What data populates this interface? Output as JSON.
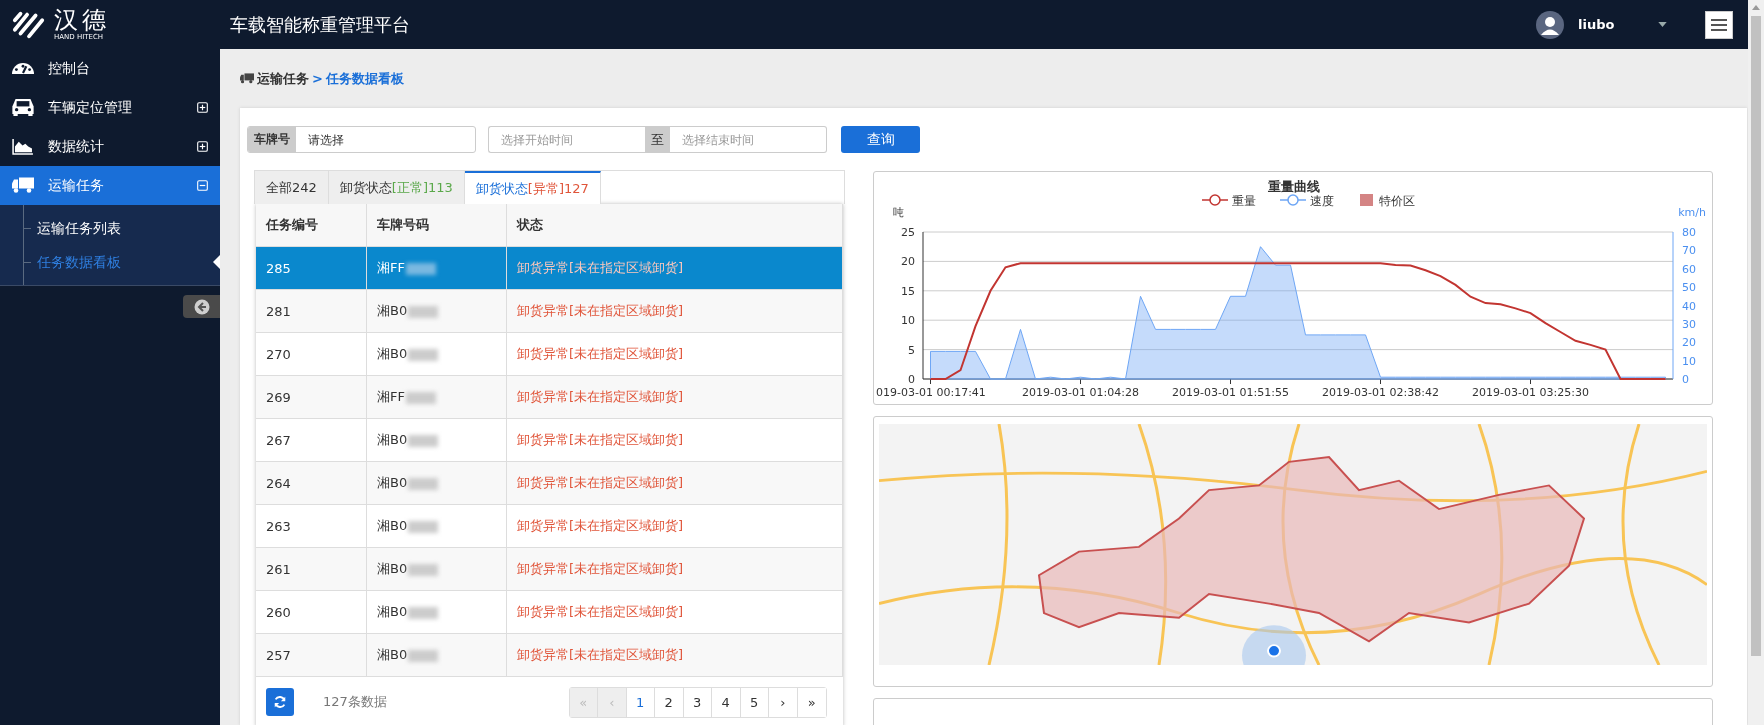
{
  "logo": {
    "name": "汉德",
    "subtitle": "HAND HITECH"
  },
  "header": {
    "title": "车载智能称重管理平台",
    "user": "liubo"
  },
  "sidebar": {
    "items": [
      {
        "label": "控制台",
        "kind": "gauge",
        "selected": false
      },
      {
        "label": "车辆定位管理",
        "kind": "car",
        "expanded": false,
        "selected": false
      },
      {
        "label": "数据统计",
        "kind": "chart",
        "expanded": false,
        "selected": false
      },
      {
        "label": "运输任务",
        "kind": "truck",
        "expanded": true,
        "selected": true,
        "children": [
          {
            "label": "运输任务列表",
            "selected": false
          },
          {
            "label": "任务数据看板",
            "selected": true
          }
        ]
      }
    ]
  },
  "breadcrumb": {
    "items": [
      "运输任务",
      "任务数据看板"
    ],
    "separator": ">"
  },
  "filters": {
    "plate_label": "车牌号",
    "plate_placeholder": "请选择",
    "start_placeholder": "选择开始时间",
    "range_separator": "至",
    "end_placeholder": "选择结束时间",
    "query_button": "查询"
  },
  "tabs": [
    {
      "label": "全部",
      "count": "242",
      "selected": false
    },
    {
      "label": "卸货状态",
      "status": "[正常]",
      "count": "113",
      "color": "#5aa84a",
      "selected": false
    },
    {
      "label": "卸货状态",
      "status": "[异常]",
      "count": "127",
      "color": "#e0553a",
      "selected": true
    }
  ],
  "table": {
    "columns": [
      "任务编号",
      "车牌号码",
      "状态"
    ],
    "rows": [
      {
        "id": "285",
        "plate": "湘FF",
        "status": "卸货异常[未在指定区域卸货]",
        "selected": true
      },
      {
        "id": "281",
        "plate": "湘B0",
        "status": "卸货异常[未在指定区域卸货]",
        "selected": false
      },
      {
        "id": "270",
        "plate": "湘B0",
        "status": "卸货异常[未在指定区域卸货]",
        "selected": false
      },
      {
        "id": "269",
        "plate": "湘FF",
        "status": "卸货异常[未在指定区域卸货]",
        "selected": false
      },
      {
        "id": "267",
        "plate": "湘B0",
        "status": "卸货异常[未在指定区域卸货]",
        "selected": false
      },
      {
        "id": "264",
        "plate": "湘B0",
        "status": "卸货异常[未在指定区域卸货]",
        "selected": false
      },
      {
        "id": "263",
        "plate": "湘B0",
        "status": "卸货异常[未在指定区域卸货]",
        "selected": false
      },
      {
        "id": "261",
        "plate": "湘B0",
        "status": "卸货异常[未在指定区域卸货]",
        "selected": false
      },
      {
        "id": "260",
        "plate": "湘B0",
        "status": "卸货异常[未在指定区域卸货]",
        "selected": false
      },
      {
        "id": "257",
        "plate": "湘B0",
        "status": "卸货异常[未在指定区域卸货]",
        "selected": false
      }
    ]
  },
  "pagination": {
    "total": "127条数据",
    "pages": [
      {
        "label": "«",
        "disabled": true,
        "selected": false
      },
      {
        "label": "‹",
        "disabled": true,
        "selected": false
      },
      {
        "label": "1",
        "disabled": false,
        "selected": true
      },
      {
        "label": "2",
        "disabled": false,
        "selected": false
      },
      {
        "label": "3",
        "disabled": false,
        "selected": false
      },
      {
        "label": "4",
        "disabled": false,
        "selected": false
      },
      {
        "label": "5",
        "disabled": false,
        "selected": false
      },
      {
        "label": "›",
        "disabled": false,
        "selected": false
      },
      {
        "label": "»",
        "disabled": false,
        "selected": false
      }
    ]
  },
  "chart": {
    "zone_legend": {
      "label": "特价区",
      "color": "#d48484"
    },
    "chart_data": {
      "type": "line",
      "title": "重量曲线",
      "ylabel": "吨",
      "y2label": "km/h",
      "categories": [
        "019-03-01 00:17:41",
        null,
        null,
        null,
        null,
        null,
        null,
        null,
        null,
        null,
        "2019-03-01 01:04:28",
        null,
        null,
        null,
        null,
        null,
        null,
        null,
        null,
        null,
        "2019-03-01 01:51:55",
        null,
        null,
        null,
        null,
        null,
        null,
        null,
        null,
        null,
        "2019-03-01 02:38:42",
        null,
        null,
        null,
        null,
        null,
        null,
        null,
        null,
        null,
        "2019-03-01 03:25:30",
        null,
        null,
        null,
        null,
        null,
        null,
        null,
        null,
        null
      ],
      "ylim": [
        0,
        25
      ],
      "y2lim": [
        0,
        80
      ],
      "grid": true,
      "legend": "top",
      "yticks": [
        0,
        5,
        10,
        15,
        20,
        25
      ],
      "y2ticks": [
        0,
        10,
        20,
        30,
        40,
        50,
        60,
        70,
        80
      ],
      "series": [
        {
          "name": "重量",
          "color": "#c23531",
          "values": [
            0,
            0,
            1.5,
            9,
            15,
            19,
            19.7,
            19.7,
            19.7,
            19.7,
            19.7,
            19.7,
            19.7,
            19.7,
            19.7,
            19.7,
            19.7,
            19.7,
            19.7,
            19.7,
            19.7,
            19.7,
            19.7,
            19.7,
            19.7,
            19.7,
            19.7,
            19.7,
            19.7,
            19.7,
            19.7,
            19.4,
            19.3,
            18.5,
            17.5,
            16,
            14,
            12.9,
            12.7,
            12,
            11.2,
            9.5,
            8,
            6.5,
            5.8,
            5,
            0,
            0,
            0,
            0
          ]
        },
        {
          "name": "速度",
          "color": "#6ea6f5",
          "axis": "y2",
          "type": "area",
          "values": [
            15,
            15,
            15,
            15,
            0,
            0,
            27,
            0,
            1,
            0,
            1,
            0,
            1,
            0,
            45,
            27,
            27,
            27,
            27,
            27,
            45,
            45,
            72,
            62,
            62,
            24,
            24,
            24,
            24,
            24,
            1,
            1,
            1,
            1,
            1,
            1,
            1,
            1,
            1,
            1,
            1,
            1,
            1,
            1,
            1,
            1,
            1,
            1,
            1,
            1
          ]
        }
      ]
    }
  }
}
